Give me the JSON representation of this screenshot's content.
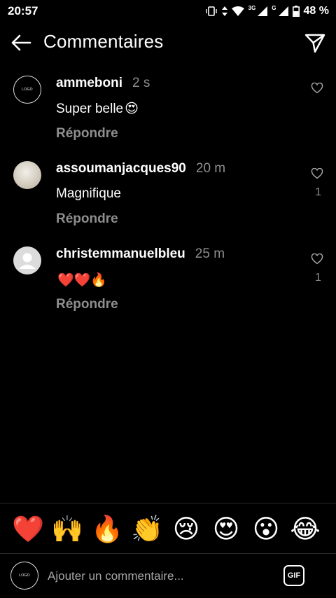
{
  "status_bar": {
    "time": "20:57",
    "network": "3G",
    "network2": "G",
    "battery": "48 %"
  },
  "header": {
    "title": "Commentaires"
  },
  "comments": [
    {
      "username": "ammeboni",
      "time": "2 s",
      "text": "Super belle",
      "emoji": "😍",
      "reply": "Répondre",
      "likes": ""
    },
    {
      "username": "assoumanjacques90",
      "time": "20 m",
      "text": "Magnifique",
      "emoji": "",
      "reply": "Répondre",
      "likes": "1"
    },
    {
      "username": "christemmanuelbleu",
      "time": "25 m",
      "text": "",
      "emoji": "❤️❤️🔥",
      "reply": "Répondre",
      "likes": "1"
    }
  ],
  "quick_reactions": [
    "❤️",
    "🙌",
    "🔥",
    "👏",
    "😢",
    "😍",
    "😮",
    "😂"
  ],
  "composer": {
    "placeholder": "Ajouter un commentaire...",
    "gif_label": "GIF"
  },
  "brand_avatar_text": "LOGO"
}
